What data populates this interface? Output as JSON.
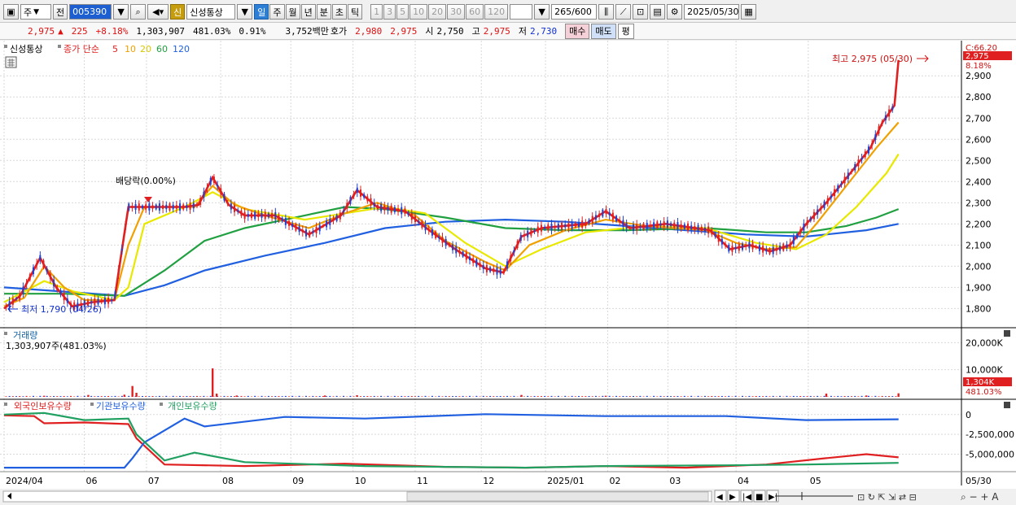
{
  "toolbar": {
    "market_select": "주",
    "prev_label": "전",
    "stock_code": "005390",
    "credit_badge": "신",
    "stock_name": "신성통상",
    "periods": [
      {
        "label": "일",
        "selected": true
      },
      {
        "label": "주",
        "selected": false
      },
      {
        "label": "월",
        "selected": false
      },
      {
        "label": "년",
        "selected": false
      },
      {
        "label": "분",
        "selected": false
      },
      {
        "label": "초",
        "selected": false
      },
      {
        "label": "틱",
        "selected": false
      }
    ],
    "intervals": [
      "1",
      "3",
      "5",
      "10",
      "20",
      "30",
      "60",
      "120"
    ],
    "count": "265",
    "count_max": "/600",
    "date": "2025/05/30"
  },
  "quote": {
    "price": "2,975",
    "change_arrow": "▲",
    "change": "225",
    "change_pct": "+8.18%",
    "volume": "1,303,907",
    "volume_ratio": "481.03%",
    "turnover": "0.91%",
    "amount": "3,752백만",
    "hoga_label": "호가",
    "ask": "2,980",
    "bid": "2,975",
    "open_label": "시",
    "open": "2,750",
    "high_label": "고",
    "high": "2,975",
    "low_label": "저",
    "low": "2,730",
    "buy_label": "매수",
    "sell_label": "매도",
    "avg_label": "평"
  },
  "price_pane": {
    "legend": {
      "stock": "신성통상",
      "title": "종가 단순",
      "ma": [
        {
          "period": "5",
          "color": "#e02020"
        },
        {
          "period": "10",
          "color": "#f0a000"
        },
        {
          "period": "20",
          "color": "#e8e800"
        },
        {
          "period": "60",
          "color": "#20a040"
        },
        {
          "period": "120",
          "color": "#2060e0"
        }
      ]
    },
    "scale_top": "C:66.20",
    "current_tag": "2,975",
    "current_pct": "8.18%",
    "high_note": "최고 2,975 (05/30)",
    "low_note": "최저 1,790 (04/26)",
    "dividend_note": "배당락(0.00%)"
  },
  "volume_pane": {
    "title": "거래량",
    "value_text": "1,303,907주(481.03%)",
    "current_tag": "1,304K",
    "current_pct": "481.03%"
  },
  "holders_pane": {
    "legend": [
      {
        "name": "외국인보유수량",
        "color": "#e02020"
      },
      {
        "name": "기관보유수량",
        "color": "#2060e0"
      },
      {
        "name": "개인보유수량",
        "color": "#20a060"
      }
    ]
  },
  "bottom_controls": [
    "◀",
    "▶",
    "|◀",
    "■",
    "▶|"
  ],
  "chart_data": [
    {
      "type": "line",
      "title": "신성통상 종가 단순 이동평균",
      "y_ticks": [
        1800,
        1900,
        2000,
        2100,
        2200,
        2300,
        2400,
        2500,
        2600,
        2700,
        2800,
        2900
      ],
      "ylim": [
        1740,
        3020
      ],
      "x_ticks": [
        "2024/04",
        "06",
        "07",
        "08",
        "09",
        "10",
        "11",
        "12",
        "2025/01",
        "02",
        "03",
        "04",
        "05",
        "05/30"
      ],
      "x_tick_pos": [
        0,
        40,
        71,
        108,
        143,
        174,
        205,
        238,
        270,
        301,
        331,
        365,
        401,
        450
      ],
      "x_range": [
        0,
        464
      ],
      "series": [
        {
          "name": "5",
          "color": "#e02020",
          "points": [
            [
              0,
              1800
            ],
            [
              8,
              1860
            ],
            [
              18,
              2040
            ],
            [
              26,
              1900
            ],
            [
              34,
              1810
            ],
            [
              44,
              1830
            ],
            [
              55,
              1840
            ],
            [
              62,
              2280
            ],
            [
              70,
              2280
            ],
            [
              90,
              2280
            ],
            [
              97,
              2290
            ],
            [
              104,
              2420
            ],
            [
              112,
              2290
            ],
            [
              120,
              2240
            ],
            [
              135,
              2240
            ],
            [
              152,
              2150
            ],
            [
              168,
              2240
            ],
            [
              176,
              2360
            ],
            [
              186,
              2280
            ],
            [
              200,
              2260
            ],
            [
              212,
              2170
            ],
            [
              225,
              2080
            ],
            [
              240,
              1990
            ],
            [
              249,
              1970
            ],
            [
              258,
              2140
            ],
            [
              268,
              2180
            ],
            [
              290,
              2200
            ],
            [
              300,
              2260
            ],
            [
              312,
              2180
            ],
            [
              330,
              2200
            ],
            [
              352,
              2170
            ],
            [
              362,
              2080
            ],
            [
              372,
              2100
            ],
            [
              382,
              2070
            ],
            [
              392,
              2100
            ],
            [
              400,
              2200
            ],
            [
              410,
              2300
            ],
            [
              422,
              2440
            ],
            [
              432,
              2560
            ],
            [
              438,
              2680
            ],
            [
              444,
              2760
            ],
            [
              446,
              2975
            ]
          ]
        },
        {
          "name": "10",
          "color": "#f0a000",
          "points": [
            [
              0,
              1810
            ],
            [
              10,
              1850
            ],
            [
              20,
              2000
            ],
            [
              30,
              1900
            ],
            [
              40,
              1840
            ],
            [
              55,
              1840
            ],
            [
              62,
              2100
            ],
            [
              70,
              2280
            ],
            [
              95,
              2280
            ],
            [
              104,
              2380
            ],
            [
              115,
              2290
            ],
            [
              130,
              2240
            ],
            [
              152,
              2180
            ],
            [
              170,
              2250
            ],
            [
              186,
              2300
            ],
            [
              205,
              2240
            ],
            [
              220,
              2120
            ],
            [
              240,
              2020
            ],
            [
              250,
              1980
            ],
            [
              262,
              2100
            ],
            [
              280,
              2170
            ],
            [
              300,
              2220
            ],
            [
              320,
              2190
            ],
            [
              350,
              2170
            ],
            [
              365,
              2110
            ],
            [
              380,
              2080
            ],
            [
              395,
              2090
            ],
            [
              405,
              2200
            ],
            [
              420,
              2380
            ],
            [
              435,
              2560
            ],
            [
              446,
              2680
            ]
          ]
        },
        {
          "name": "20",
          "color": "#e8e800",
          "points": [
            [
              0,
              1830
            ],
            [
              20,
              1930
            ],
            [
              35,
              1880
            ],
            [
              55,
              1840
            ],
            [
              62,
              1900
            ],
            [
              70,
              2200
            ],
            [
              90,
              2280
            ],
            [
              104,
              2350
            ],
            [
              120,
              2270
            ],
            [
              150,
              2220
            ],
            [
              170,
              2250
            ],
            [
              190,
              2280
            ],
            [
              210,
              2250
            ],
            [
              230,
              2110
            ],
            [
              250,
              2000
            ],
            [
              268,
              2080
            ],
            [
              290,
              2160
            ],
            [
              320,
              2190
            ],
            [
              350,
              2180
            ],
            [
              375,
              2110
            ],
            [
              395,
              2080
            ],
            [
              410,
              2150
            ],
            [
              425,
              2280
            ],
            [
              440,
              2440
            ],
            [
              446,
              2530
            ]
          ]
        },
        {
          "name": "60",
          "color": "#20a040",
          "points": [
            [
              0,
              1870
            ],
            [
              30,
              1870
            ],
            [
              60,
              1860
            ],
            [
              80,
              1980
            ],
            [
              100,
              2120
            ],
            [
              120,
              2180
            ],
            [
              150,
              2240
            ],
            [
              170,
              2280
            ],
            [
              190,
              2270
            ],
            [
              220,
              2230
            ],
            [
              250,
              2180
            ],
            [
              280,
              2170
            ],
            [
              310,
              2170
            ],
            [
              350,
              2180
            ],
            [
              380,
              2160
            ],
            [
              400,
              2160
            ],
            [
              420,
              2190
            ],
            [
              435,
              2230
            ],
            [
              446,
              2270
            ]
          ]
        },
        {
          "name": "120",
          "color": "#2060e0",
          "points": [
            [
              0,
              1900
            ],
            [
              30,
              1880
            ],
            [
              60,
              1860
            ],
            [
              80,
              1910
            ],
            [
              100,
              1980
            ],
            [
              130,
              2050
            ],
            [
              160,
              2110
            ],
            [
              190,
              2180
            ],
            [
              220,
              2210
            ],
            [
              250,
              2220
            ],
            [
              280,
              2210
            ],
            [
              310,
              2190
            ],
            [
              340,
              2170
            ],
            [
              370,
              2150
            ],
            [
              400,
              2140
            ],
            [
              430,
              2170
            ],
            [
              446,
              2200
            ]
          ]
        }
      ]
    },
    {
      "type": "bar",
      "title": "거래량",
      "y_ticks": [
        10000,
        20000
      ],
      "ylim": [
        0,
        24000
      ],
      "unit": "K",
      "spikes": [
        [
          20,
          400
        ],
        [
          42,
          700
        ],
        [
          60,
          800
        ],
        [
          64,
          4000
        ],
        [
          66,
          1500
        ],
        [
          104,
          10500
        ],
        [
          106,
          1200
        ],
        [
          116,
          500
        ],
        [
          160,
          500
        ],
        [
          176,
          600
        ],
        [
          258,
          700
        ],
        [
          300,
          400
        ],
        [
          410,
          1200
        ],
        [
          430,
          500
        ],
        [
          446,
          1304
        ]
      ],
      "base_level": 250
    },
    {
      "type": "line",
      "title": "보유수량",
      "y_ticks": [
        0,
        -2500000,
        -5000000
      ],
      "ylim": [
        -7000000,
        800000
      ],
      "series": [
        {
          "name": "외국인보유수량",
          "color": "#e02020",
          "points": [
            [
              0,
              -100000
            ],
            [
              15,
              -200000
            ],
            [
              20,
              -1100000
            ],
            [
              40,
              -1000000
            ],
            [
              62,
              -1200000
            ],
            [
              66,
              -3000000
            ],
            [
              80,
              -6300000
            ],
            [
              120,
              -6500000
            ],
            [
              170,
              -6200000
            ],
            [
              220,
              -6600000
            ],
            [
              260,
              -6700000
            ],
            [
              300,
              -6500000
            ],
            [
              340,
              -6700000
            ],
            [
              380,
              -6300000
            ],
            [
              410,
              -5500000
            ],
            [
              430,
              -5000000
            ],
            [
              446,
              -5400000
            ]
          ]
        },
        {
          "name": "기관보유수량",
          "color": "#2060e0",
          "points": [
            [
              0,
              -6700000
            ],
            [
              60,
              -6700000
            ],
            [
              64,
              -5500000
            ],
            [
              70,
              -3500000
            ],
            [
              80,
              -2000000
            ],
            [
              90,
              -500000
            ],
            [
              100,
              -1500000
            ],
            [
              140,
              -300000
            ],
            [
              180,
              -500000
            ],
            [
              240,
              50000
            ],
            [
              300,
              -200000
            ],
            [
              360,
              -200000
            ],
            [
              400,
              -700000
            ],
            [
              446,
              -600000
            ]
          ]
        },
        {
          "name": "개인보유수량",
          "color": "#20a060",
          "points": [
            [
              0,
              0
            ],
            [
              20,
              200000
            ],
            [
              40,
              -700000
            ],
            [
              62,
              -500000
            ],
            [
              66,
              -2500000
            ],
            [
              80,
              -5800000
            ],
            [
              95,
              -4800000
            ],
            [
              120,
              -6000000
            ],
            [
              180,
              -6500000
            ],
            [
              220,
              -6600000
            ],
            [
              260,
              -6700000
            ],
            [
              300,
              -6500000
            ],
            [
              360,
              -6400000
            ],
            [
              400,
              -6300000
            ],
            [
              446,
              -6100000
            ]
          ]
        }
      ]
    }
  ]
}
